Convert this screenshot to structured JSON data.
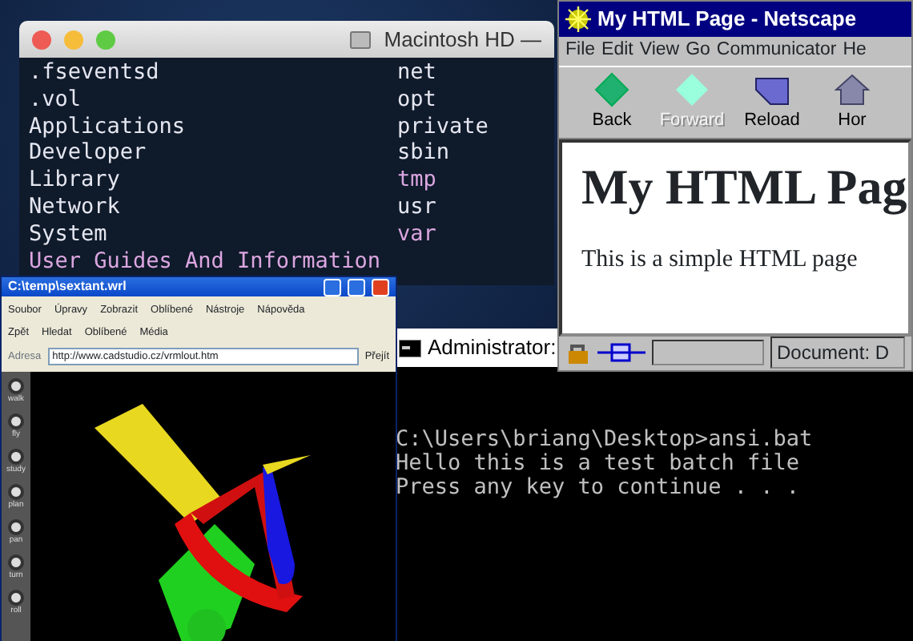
{
  "terminal": {
    "title": "Macintosh HD —",
    "columns": [
      [
        {
          "text": ".fseventsd",
          "color": "#e4e6f0"
        },
        {
          "text": ".vol",
          "color": "#e4e6f0"
        },
        {
          "text": "Applications",
          "color": "#e4e6f0"
        },
        {
          "text": "Developer",
          "color": "#e4e6f0"
        },
        {
          "text": "Library",
          "color": "#e4e6f0"
        },
        {
          "text": "Network",
          "color": "#e4e6f0"
        },
        {
          "text": "System",
          "color": "#e4e6f0"
        },
        {
          "text": "User Guides And Information",
          "color": "#dba6e0"
        }
      ],
      [
        {
          "text": "net",
          "color": "#e4e6f0"
        },
        {
          "text": "opt",
          "color": "#e4e6f0"
        },
        {
          "text": "private",
          "color": "#e4e6f0"
        },
        {
          "text": "sbin",
          "color": "#e4e6f0"
        },
        {
          "text": "tmp",
          "color": "#dba6e0"
        },
        {
          "text": "usr",
          "color": "#e4e6f0"
        },
        {
          "text": "var",
          "color": "#dba6e0"
        }
      ]
    ]
  },
  "netscape": {
    "title": "My HTML Page - Netscape",
    "menu": [
      "File",
      "Edit",
      "View",
      "Go",
      "Communicator",
      "He"
    ],
    "toolbar": [
      {
        "label": "Back",
        "disabled": false
      },
      {
        "label": "Forward",
        "disabled": true
      },
      {
        "label": "Reload",
        "disabled": false
      },
      {
        "label": "Hor",
        "disabled": false
      }
    ],
    "heading": "My HTML Pag",
    "paragraph": "This is a simple HTML page",
    "status": "Document: D"
  },
  "console": {
    "title": "Administrator:",
    "lines": [
      "C:\\Users\\briang\\Desktop>ansi.bat",
      "Hello this is a test batch file",
      "Press any key to continue . . ."
    ]
  },
  "explorer": {
    "title": "C:\\temp\\sextant.wrl",
    "menu": [
      "Soubor",
      "Úpravy",
      "Zobrazit",
      "Oblíbené",
      "Nástroje",
      "Nápověda"
    ],
    "toolbar": [
      "Zpět",
      "Hledat",
      "Oblíbené",
      "Média"
    ],
    "address_label": "Adresa",
    "address": "http://www.cadstudio.cz/vrmlout.htm",
    "go": "Přejít",
    "viewer_buttons": [
      "walk",
      "fly",
      "study",
      "plan",
      "pan",
      "turn",
      "roll"
    ]
  }
}
